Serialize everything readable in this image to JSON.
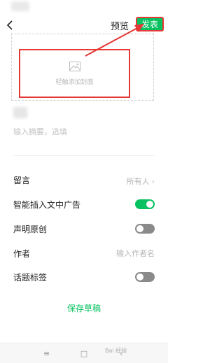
{
  "header": {
    "preview_label": "预览",
    "publish_label": "发表"
  },
  "cover": {
    "label": "轻触添加封面"
  },
  "summary": {
    "placeholder": "输入摘要，选填"
  },
  "settings": {
    "comments": {
      "label": "留言",
      "value": "所有人"
    },
    "smart_ads": {
      "label": "智能插入文中广告",
      "enabled": true
    },
    "original": {
      "label": "声明原创",
      "enabled": false
    },
    "author": {
      "label": "作者",
      "placeholder": "输入作者名"
    },
    "topic_tags": {
      "label": "话题标签",
      "enabled": false
    }
  },
  "footer": {
    "save_draft_label": "保存草稿"
  },
  "watermark": "Bai 经验",
  "colors": {
    "accent": "#07c160",
    "annotation": "#e53935"
  }
}
